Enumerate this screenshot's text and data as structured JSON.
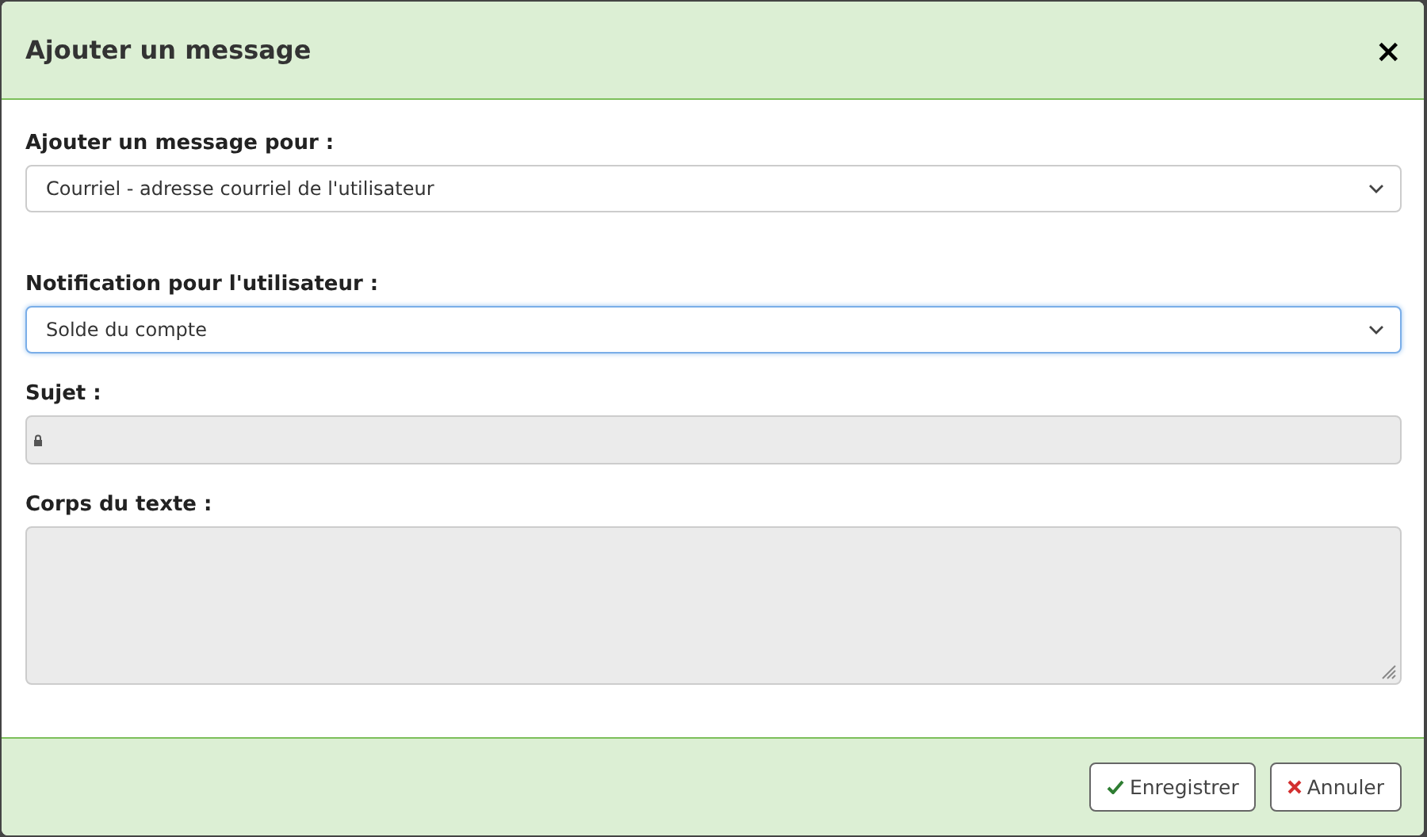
{
  "dialog": {
    "title": "Ajouter un message",
    "close": "×"
  },
  "fields": [
    {
      "kind": "select",
      "label": "Ajouter un message pour :",
      "value": "Courriel - adresse courriel de l'utilisateur",
      "focused": false,
      "disabled": false
    },
    {
      "kind": "select",
      "label": "Notification pour l'utilisateur :",
      "value": "Solde du compte",
      "focused": true,
      "disabled": false
    },
    {
      "kind": "input",
      "label": "Sujet :",
      "focused": false,
      "disabled": true,
      "locked": true
    },
    {
      "kind": "textarea",
      "label": "Corps du texte :",
      "focused": false,
      "disabled": true
    }
  ],
  "buttons": [
    {
      "kind": "save",
      "label": "Enregistrer"
    },
    {
      "kind": "cancel",
      "label": "Annuler"
    }
  ]
}
